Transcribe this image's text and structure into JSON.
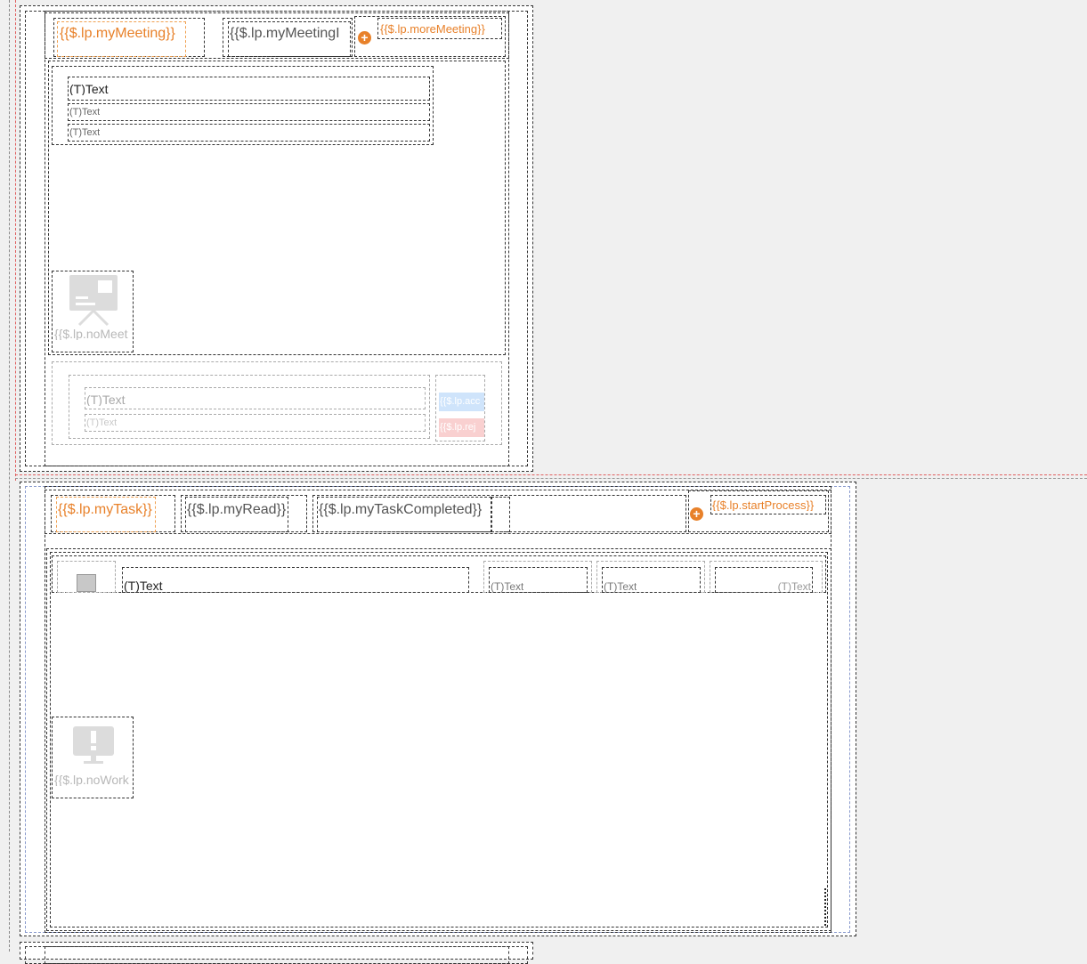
{
  "meeting": {
    "tabs": {
      "my_meeting": "{{$.lp.myMeeting}}",
      "my_meeting_invite": "{{$.lp.myMeetingI",
      "more_meeting": "{{$.lp.moreMeeting}}"
    },
    "item": {
      "title": "(T)Text",
      "line1": "(T)Text",
      "line2": "(T)Text"
    },
    "empty_label": "{{$.lp.noMeet",
    "invite": {
      "title": "(T)Text",
      "subtitle": "(T)Text",
      "accept_label": "{{$.lp.acc",
      "reject_label": "{{$.lp.rej"
    }
  },
  "task": {
    "tabs": {
      "my_task": "{{$.lp.myTask}}",
      "my_read": "{{$.lp.myRead}}",
      "my_task_completed": "{{$.lp.myTaskCompleted}}",
      "start_process": "{{$.lp.startProcess}}"
    },
    "row": {
      "title": "(T)Text",
      "col1": "(T)Text",
      "col2": "(T)Text",
      "col3": "(T)Text"
    },
    "empty_label": "{{$.lp.noWork"
  },
  "colors": {
    "accent": "#e8812a",
    "accept_bg": "#cfe4fb",
    "reject_bg": "#f9d0d0"
  }
}
